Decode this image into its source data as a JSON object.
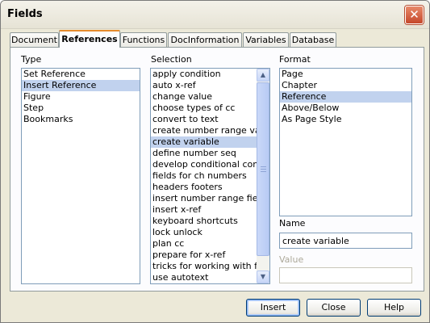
{
  "window": {
    "title": "Fields",
    "close_symbol": "✕"
  },
  "tabs": [
    {
      "label": "Document"
    },
    {
      "label": "References",
      "active": true
    },
    {
      "label": "Functions"
    },
    {
      "label": "DocInformation"
    },
    {
      "label": "Variables"
    },
    {
      "label": "Database"
    }
  ],
  "type": {
    "label": "Type",
    "items": [
      "Set Reference",
      "Insert Reference",
      "Figure",
      "Step",
      "Bookmarks"
    ],
    "selected": "Insert Reference"
  },
  "selection": {
    "label": "Selection",
    "items": [
      "apply condition",
      "auto x-ref",
      "change value",
      "choose types of cc",
      "convert to text",
      "create number range var",
      "create variable",
      "define number seq",
      "develop conditional conter",
      "fields for ch numbers",
      "headers footers",
      "insert number range field",
      "insert x-ref",
      "keyboard shortcuts",
      "lock unlock",
      "plan cc",
      "prepare for x-ref",
      "tricks for working with fielc",
      "use autotext"
    ],
    "selected": "create variable"
  },
  "format": {
    "label": "Format",
    "items": [
      "Page",
      "Chapter",
      "Reference",
      "Above/Below",
      "As Page Style"
    ],
    "selected": "Reference"
  },
  "name": {
    "label": "Name",
    "value": "create variable"
  },
  "value": {
    "label": "Value",
    "value": ""
  },
  "buttons": {
    "insert": "Insert",
    "close": "Close",
    "help": "Help"
  },
  "icons": {
    "close": "close-icon",
    "scroll_up": "scroll-up-arrow-icon",
    "scroll_down": "scroll-down-arrow-icon",
    "grip": "scrollbar-grip-icon"
  },
  "colors": {
    "dialog_bg": "#ece9d8",
    "selection_highlight": "#c1d2ee",
    "close_button": "#c5472a",
    "active_tab_accent": "#e68b2c",
    "button_border": "#003c74"
  }
}
